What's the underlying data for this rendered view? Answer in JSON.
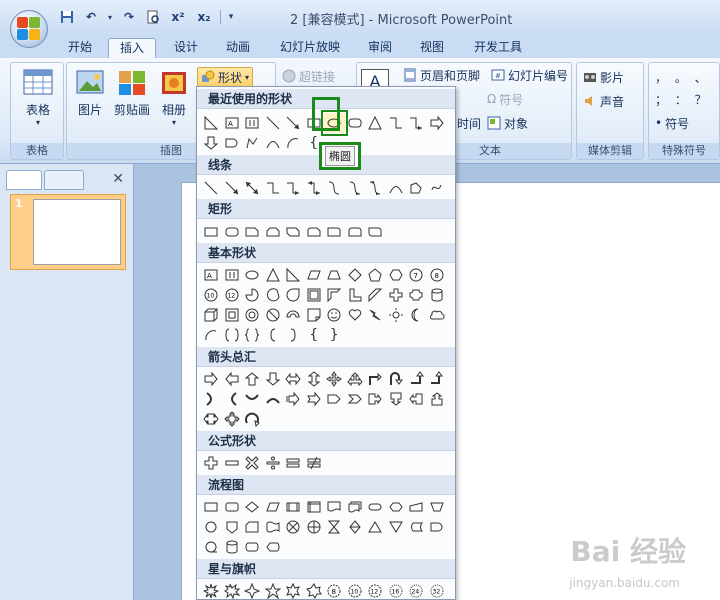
{
  "window": {
    "title": "2 [兼容模式] - Microsoft PowerPoint"
  },
  "qat": {
    "icons": [
      "save-icon",
      "undo-icon",
      "redo-icon",
      "print-preview-icon",
      "superscript-icon",
      "subscript-icon",
      "customize-qat-icon"
    ],
    "sup": "x²",
    "sub": "x₂",
    "more": "▾"
  },
  "tabs": [
    "开始",
    "插入",
    "设计",
    "动画",
    "幻灯片放映",
    "审阅",
    "视图",
    "开发工具"
  ],
  "active_tab": "插入",
  "ribbon": {
    "tables_group": {
      "label": "表格",
      "table_btn": "表格",
      "arrow": "▾"
    },
    "illustrations_group": {
      "label": "插图",
      "picture": "图片",
      "clipart": "剪贴画",
      "album": "相册",
      "shapes": "形状"
    },
    "links_group": {
      "hyperlink": "超链接"
    },
    "text_group": {
      "label": "文本",
      "textbox_letter": "A",
      "header_footer": "页眉和页脚",
      "slide_number": "幻灯片编号",
      "symbol": "符号",
      "datetime": "时间",
      "object": "对象"
    },
    "media_group": {
      "label": "媒体剪辑",
      "movie": "影片",
      "sound": "声音"
    },
    "special_group": {
      "label": "特殊符号",
      "symbols_row1": "， 。 、",
      "symbols_row2": "； ： ？",
      "symbol_btn": "符号"
    }
  },
  "left_panel": {
    "close": "✕",
    "slide_number": "1"
  },
  "shapes_menu": {
    "sections": [
      "最近使用的形状",
      "线条",
      "矩形",
      "基本形状",
      "箭头总汇",
      "公式形状",
      "流程图",
      "星与旗帜"
    ],
    "tooltip": "椭圆",
    "braces": [
      "{",
      "}"
    ]
  },
  "watermark": {
    "main": "Bai  经验",
    "sub": "jingyan.baidu.com"
  },
  "colors": {
    "highlight": "#1a8a1a",
    "ribbon_bg": "#dde9f7",
    "tab_active": "#f5f8fd"
  }
}
